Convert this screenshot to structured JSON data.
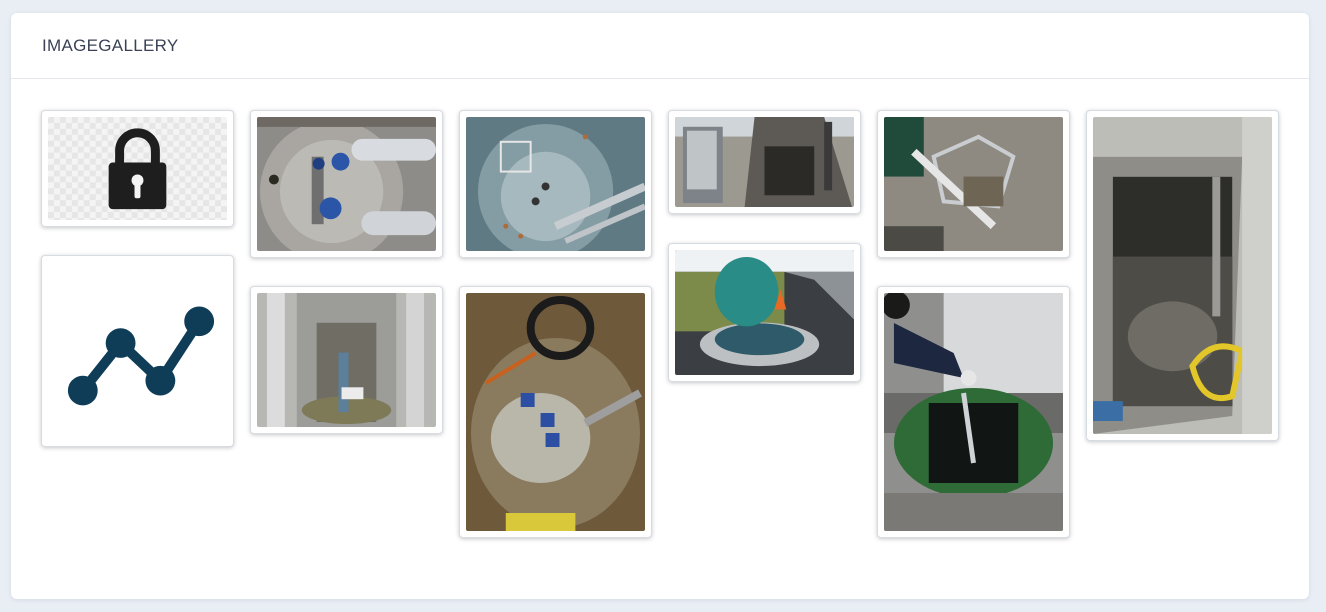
{
  "card": {
    "title": "IMAGEGALLERY"
  },
  "gallery": {
    "items": [
      {
        "name": "lock-image",
        "kind": "lock"
      },
      {
        "name": "trend-chart-image",
        "kind": "trend"
      },
      {
        "name": "valve-chamber-photo",
        "kind": "photo"
      },
      {
        "name": "pipe-shaft-photo",
        "kind": "photo"
      },
      {
        "name": "pump-well-photo",
        "kind": "photo"
      },
      {
        "name": "submersible-pump-photo",
        "kind": "photo"
      },
      {
        "name": "control-cabinet-photo",
        "kind": "photo"
      },
      {
        "name": "manhole-cover-photo",
        "kind": "photo"
      },
      {
        "name": "sensor-frame-photo",
        "kind": "photo"
      },
      {
        "name": "worker-inspection-photo",
        "kind": "photo"
      },
      {
        "name": "concrete-chamber-photo",
        "kind": "photo"
      }
    ]
  }
}
